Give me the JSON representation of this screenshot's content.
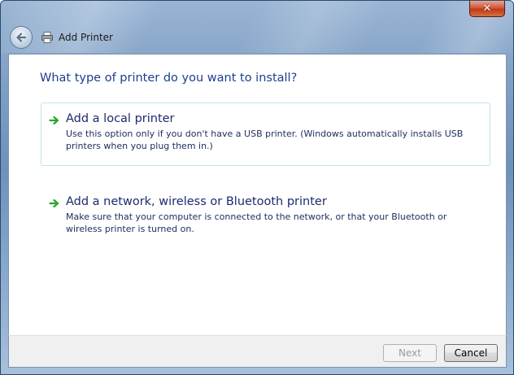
{
  "window": {
    "title": "Add Printer",
    "close_label": "✕"
  },
  "main": {
    "question": "What type of printer do you want to install?",
    "options": [
      {
        "title": "Add a local printer",
        "description": "Use this option only if you don't have a USB printer. (Windows automatically installs USB printers when you plug them in.)"
      },
      {
        "title": "Add a network, wireless or Bluetooth printer",
        "description": "Make sure that your computer is connected to the network, or that your Bluetooth or wireless printer is turned on."
      }
    ]
  },
  "footer": {
    "next_label": "Next",
    "cancel_label": "Cancel"
  },
  "icons": {
    "back": "back-arrow-icon",
    "printer": "printer-icon",
    "option_arrow": "green-arrow-icon"
  },
  "colors": {
    "heading": "#1d3e91",
    "option_arrow": "#2aa52a",
    "selected_border": "#bfe4f0"
  }
}
